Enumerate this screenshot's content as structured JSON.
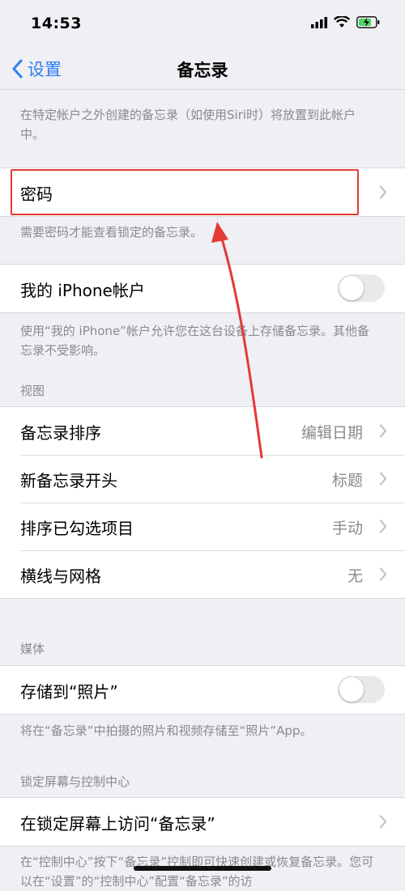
{
  "status_bar": {
    "time": "14:53"
  },
  "nav": {
    "back_label": "设置",
    "title": "备忘录"
  },
  "top_footer": "在特定帐户之外创建的备忘录（如使用Siri时）将放置到此帐户中。",
  "password_group": {
    "label": "密码",
    "footer": "需要密码才能查看锁定的备忘录。"
  },
  "iphone_account": {
    "label": "我的 iPhone帐户",
    "enabled": false,
    "footer": "使用“我的 iPhone”帐户允许您在这台设备上存储备忘录。其他备忘录不受影响。"
  },
  "view_section": {
    "header": "视图",
    "rows": [
      {
        "label": "备忘录排序",
        "value": "编辑日期"
      },
      {
        "label": "新备忘录开头",
        "value": "标题"
      },
      {
        "label": "排序已勾选项目",
        "value": "手动"
      },
      {
        "label": "横线与网格",
        "value": "无"
      }
    ]
  },
  "media_section": {
    "header": "媒体",
    "save_to_photos": {
      "label": "存储到“照片”",
      "enabled": false
    },
    "footer": "将在“备忘录”中拍摄的照片和视频存储至“照片”App。"
  },
  "lock_section": {
    "header": "锁定屏幕与控制中心",
    "row_label": "在锁定屏幕上访问“备忘录”",
    "footer": "在“控制中心”按下“备忘录”控制即可快速创建或恢复备忘录。您可以在“设置”的“控制中心”配置“备忘录”的访"
  },
  "colors": {
    "accent": "#2f7ff0",
    "annotation": "#e53935",
    "battery": "#4cd964"
  }
}
